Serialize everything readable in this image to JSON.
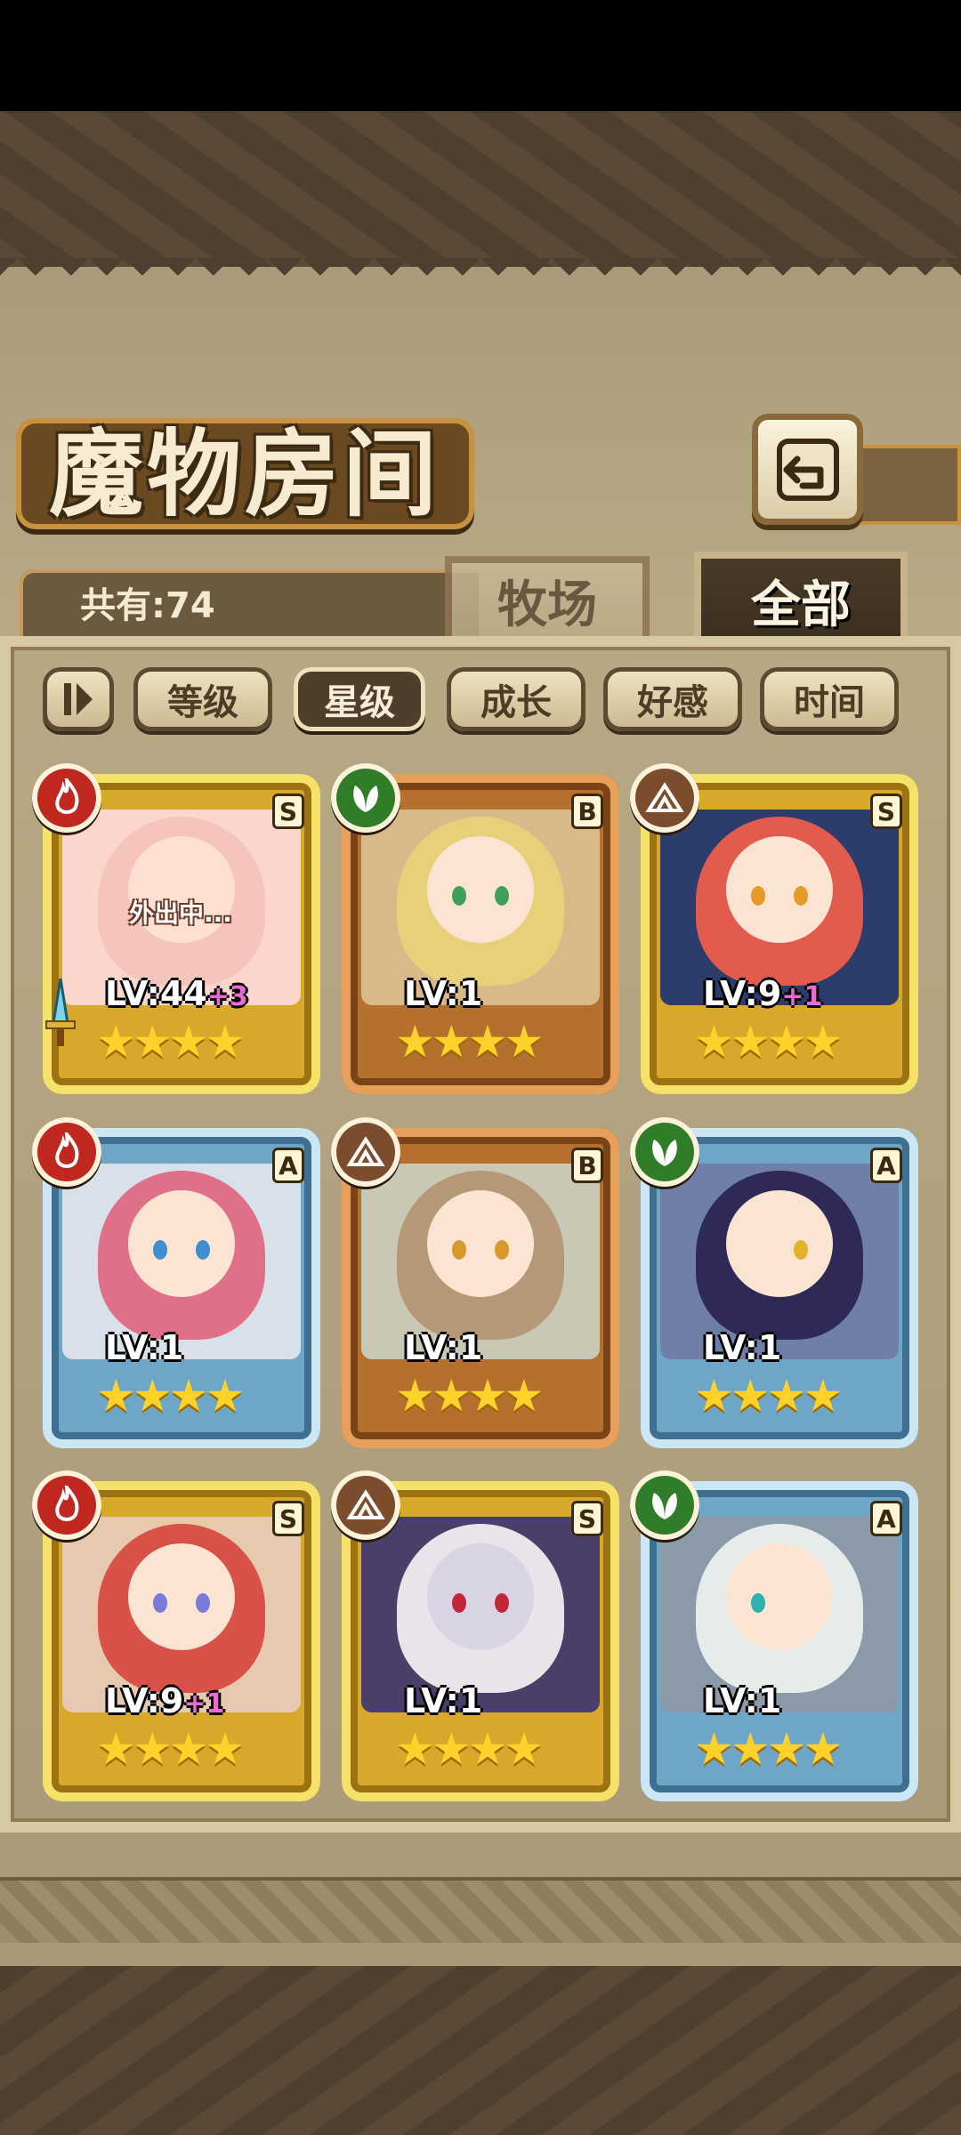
{
  "header": {
    "title": "魔物房间",
    "back_icon": "return-arrow-icon"
  },
  "count": {
    "label": "共有:74"
  },
  "tabs": [
    {
      "label": "牧场",
      "active": false
    },
    {
      "label": "全部",
      "active": true
    }
  ],
  "sort_buttons": [
    {
      "label": "等级",
      "active": false
    },
    {
      "label": "星级",
      "active": true
    },
    {
      "label": "成长",
      "active": false
    },
    {
      "label": "好感",
      "active": false
    },
    {
      "label": "时间",
      "active": false
    }
  ],
  "cards": [
    {
      "element": "fire",
      "grade": "S",
      "frame": "gold",
      "level": "LV:44",
      "bonus": "+3",
      "stars": 4,
      "status": "外出中...",
      "equipped_icon": "sword-icon"
    },
    {
      "element": "grass",
      "grade": "B",
      "frame": "bronze",
      "level": "LV:1",
      "bonus": "",
      "stars": 4
    },
    {
      "element": "earth",
      "grade": "S",
      "frame": "gold",
      "level": "LV:9",
      "bonus": "+1",
      "stars": 4
    },
    {
      "element": "fire",
      "grade": "A",
      "frame": "silver",
      "level": "LV:1",
      "bonus": "",
      "stars": 4
    },
    {
      "element": "earth",
      "grade": "B",
      "frame": "bronze",
      "level": "LV:1",
      "bonus": "",
      "stars": 4
    },
    {
      "element": "grass",
      "grade": "A",
      "frame": "silver",
      "level": "LV:1",
      "bonus": "",
      "stars": 4
    },
    {
      "element": "fire",
      "grade": "S",
      "frame": "gold",
      "level": "LV:9",
      "bonus": "+1",
      "stars": 4
    },
    {
      "element": "earth",
      "grade": "S",
      "frame": "gold",
      "level": "LV:1",
      "bonus": "",
      "stars": 4
    },
    {
      "element": "grass",
      "grade": "A",
      "frame": "silver",
      "level": "LV:1",
      "bonus": "",
      "stars": 4
    }
  ],
  "colors": {
    "fire": "#c0281f",
    "grass": "#2f7d28",
    "earth": "#7b4d2c",
    "gold": "#d8a82a",
    "bronze": "#b5702e",
    "silver": "#6ea6c8"
  }
}
